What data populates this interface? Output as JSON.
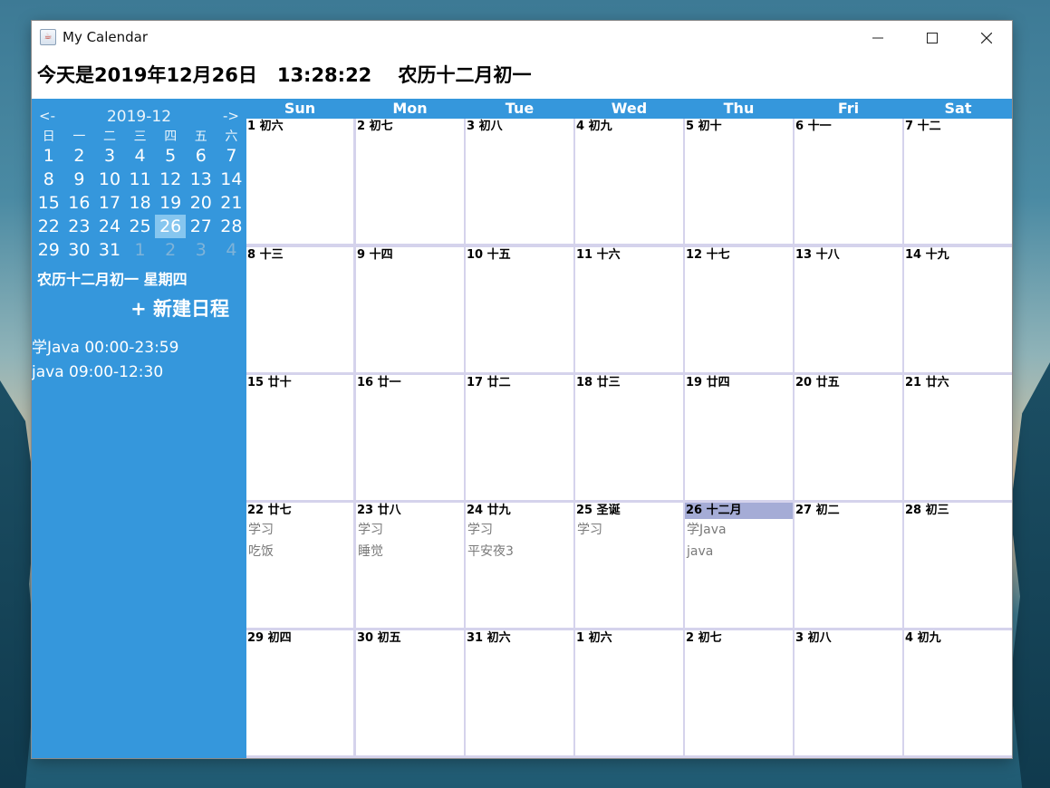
{
  "window": {
    "title": "My Calendar"
  },
  "header": {
    "today_line": "今天是2019年12月26日   13:28:22    农历十二月初一"
  },
  "mini_calendar": {
    "prev": "<-",
    "month": "2019-12",
    "next": "->",
    "weekdays": [
      "日",
      "一",
      "二",
      "三",
      "四",
      "五",
      "六"
    ],
    "days": [
      "1",
      "2",
      "3",
      "4",
      "5",
      "6",
      "7",
      "8",
      "9",
      "10",
      "11",
      "12",
      "13",
      "14",
      "15",
      "16",
      "17",
      "18",
      "19",
      "20",
      "21",
      "22",
      "23",
      "24",
      "25",
      "26",
      "27",
      "28",
      "29",
      "30",
      "31",
      "1",
      "2",
      "3",
      "4"
    ],
    "selected": "26"
  },
  "sidebar": {
    "lunar_text": "农历十二月初一 星期四",
    "new_button": "+ 新建日程",
    "events": [
      "学Java 00:00-23:59",
      "java 09:00-12:30"
    ]
  },
  "month_view": {
    "weekdays": [
      "Sun",
      "Mon",
      "Tue",
      "Wed",
      "Thu",
      "Fri",
      "Sat"
    ],
    "weeks": [
      [
        {
          "label": "1 初六",
          "events": []
        },
        {
          "label": "2 初七",
          "events": []
        },
        {
          "label": "3 初八",
          "events": []
        },
        {
          "label": "4 初九",
          "events": []
        },
        {
          "label": "5 初十",
          "events": []
        },
        {
          "label": "6 十一",
          "events": []
        },
        {
          "label": "7 十二",
          "events": []
        }
      ],
      [
        {
          "label": "8 十三",
          "events": []
        },
        {
          "label": "9 十四",
          "events": []
        },
        {
          "label": "10 十五",
          "events": []
        },
        {
          "label": "11 十六",
          "events": []
        },
        {
          "label": "12 十七",
          "events": []
        },
        {
          "label": "13 十八",
          "events": []
        },
        {
          "label": "14 十九",
          "events": []
        }
      ],
      [
        {
          "label": "15 廿十",
          "events": []
        },
        {
          "label": "16 廿一",
          "events": []
        },
        {
          "label": "17 廿二",
          "events": []
        },
        {
          "label": "18 廿三",
          "events": []
        },
        {
          "label": "19 廿四",
          "events": []
        },
        {
          "label": "20 廿五",
          "events": []
        },
        {
          "label": "21 廿六",
          "events": []
        }
      ],
      [
        {
          "label": "22 廿七",
          "events": [
            "学习",
            "吃饭"
          ]
        },
        {
          "label": "23 廿八",
          "events": [
            "学习",
            "睡觉"
          ]
        },
        {
          "label": "24 廿九",
          "events": [
            "学习",
            "平安夜3"
          ]
        },
        {
          "label": "25 圣诞",
          "events": [
            "学习"
          ]
        },
        {
          "label": "26 十二月",
          "events": [
            "学Java",
            "java"
          ],
          "today": true
        },
        {
          "label": "27 初二",
          "events": []
        },
        {
          "label": "28 初三",
          "events": []
        }
      ],
      [
        {
          "label": "29 初四",
          "events": []
        },
        {
          "label": "30 初五",
          "events": []
        },
        {
          "label": "31 初六",
          "events": []
        },
        {
          "label": "1 初六",
          "events": []
        },
        {
          "label": "2 初七",
          "events": []
        },
        {
          "label": "3 初八",
          "events": []
        },
        {
          "label": "4 初九",
          "events": []
        }
      ]
    ]
  },
  "colors": {
    "accent": "#3597dc",
    "grid_line": "#d5d3ec",
    "today_highlight": "#a5acd6",
    "mini_selected": "#86c6ef"
  }
}
